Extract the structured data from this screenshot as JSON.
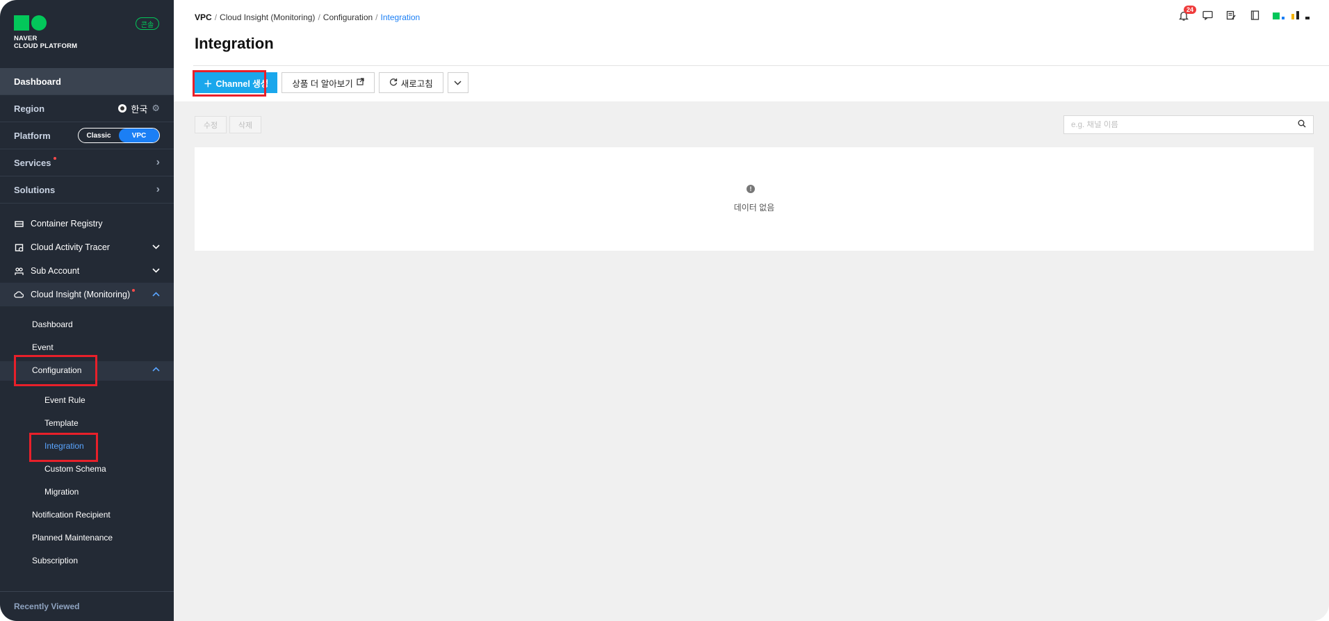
{
  "sidebar": {
    "logo_line1": "NAVER",
    "logo_line2": "CLOUD PLATFORM",
    "console_badge": "콘솔",
    "dashboard": "Dashboard",
    "region_label": "Region",
    "region_value": "한국",
    "platform_label": "Platform",
    "platform_options": [
      "Classic",
      "VPC"
    ],
    "platform_selected": "VPC",
    "services_label": "Services",
    "solutions_label": "Solutions",
    "menu": [
      {
        "label": "Container Registry",
        "icon": "registry-icon"
      },
      {
        "label": "Cloud Activity Tracer",
        "icon": "tracer-icon"
      },
      {
        "label": "Sub Account",
        "icon": "sub-account-icon"
      },
      {
        "label": "Cloud Insight (Monitoring)",
        "icon": "cloud-insight-icon"
      }
    ],
    "cloud_insight_children": [
      "Dashboard",
      "Event",
      "Configuration"
    ],
    "configuration_children": [
      "Event Rule",
      "Template",
      "Integration",
      "Custom Schema",
      "Migration"
    ],
    "more_children": [
      "Notification Recipient",
      "Planned Maintenance",
      "Subscription"
    ],
    "recently_viewed": "Recently Viewed"
  },
  "header": {
    "breadcrumb": [
      "VPC",
      "Cloud Insight (Monitoring)",
      "Configuration",
      "Integration"
    ],
    "title": "Integration",
    "notification_count": "24"
  },
  "toolbar": {
    "create_channel": "Channel 생성",
    "learn_more": "상품 더 알아보기",
    "refresh": "새로고침"
  },
  "content": {
    "edit_button": "수정",
    "delete_button": "삭제",
    "search_placeholder": "e.g. 채널 이름",
    "empty_message": "데이터 없음"
  },
  "colors": {
    "sidebar_bg": "#232a35",
    "accent_blue": "#1b7ff5",
    "primary_button": "#1aa7ec",
    "naver_green": "#03c75a",
    "highlight_red": "#e8202a"
  }
}
